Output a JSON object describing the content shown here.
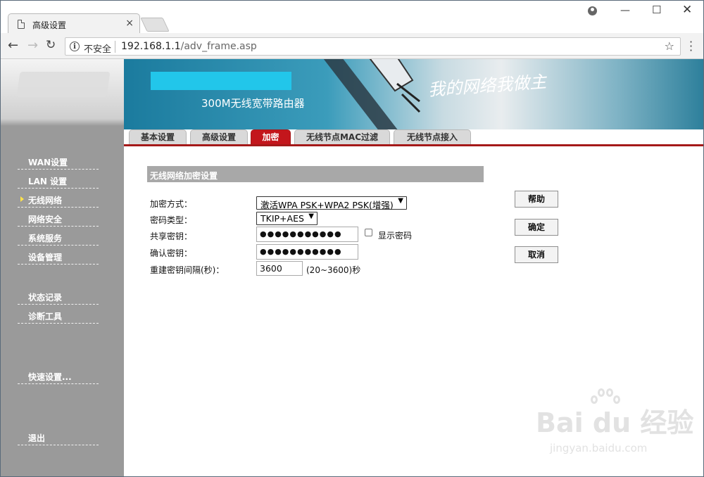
{
  "browser": {
    "tab_title": "高级设置",
    "tab_close": "×",
    "security_label": "不安全",
    "url_host": "192.168.1.1",
    "url_path": "/adv_frame.asp"
  },
  "banner": {
    "product": "300M无线宽带路由器",
    "slogan": "我的网络我做主"
  },
  "sidebar": {
    "items": [
      {
        "label": "WAN设置"
      },
      {
        "label": "LAN 设置"
      },
      {
        "label": "无线网络",
        "active": true
      },
      {
        "label": "网络安全"
      },
      {
        "label": "系统服务"
      },
      {
        "label": "设备管理"
      },
      {
        "label": "状态记录"
      },
      {
        "label": "诊断工具"
      },
      {
        "label": "快速设置..."
      },
      {
        "label": "退出"
      }
    ]
  },
  "tabs": [
    {
      "label": "基本设置"
    },
    {
      "label": "高级设置"
    },
    {
      "label": "加密",
      "active": true
    },
    {
      "label": "无线节点MAC过滤"
    },
    {
      "label": "无线节点接入"
    }
  ],
  "form": {
    "section_title": "无线网络加密设置",
    "encryption_label": "加密方式：",
    "encryption_value": "激活WPA PSK+WPA2 PSK(增强)",
    "cipher_label": "密码类型：",
    "cipher_value": "TKIP+AES",
    "psk_label": "共享密钥：",
    "psk_value": "●●●●●●●●●●●",
    "show_password_label": "显示密码",
    "confirm_label": "确认密钥：",
    "confirm_value": "●●●●●●●●●●●",
    "rekey_label": "重建密钥间隔(秒)：",
    "rekey_value": "3600",
    "rekey_range": "(20~3600)秒"
  },
  "buttons": {
    "help": "帮助",
    "ok": "确定",
    "cancel": "取消"
  },
  "watermark": {
    "brand": "Bai du 经验",
    "url": "jingyan.baidu.com"
  },
  "colors": {
    "accent_red": "#c3161c",
    "sidebar_gray": "#9a9a9a",
    "banner_blue": "#1b7b9e"
  }
}
